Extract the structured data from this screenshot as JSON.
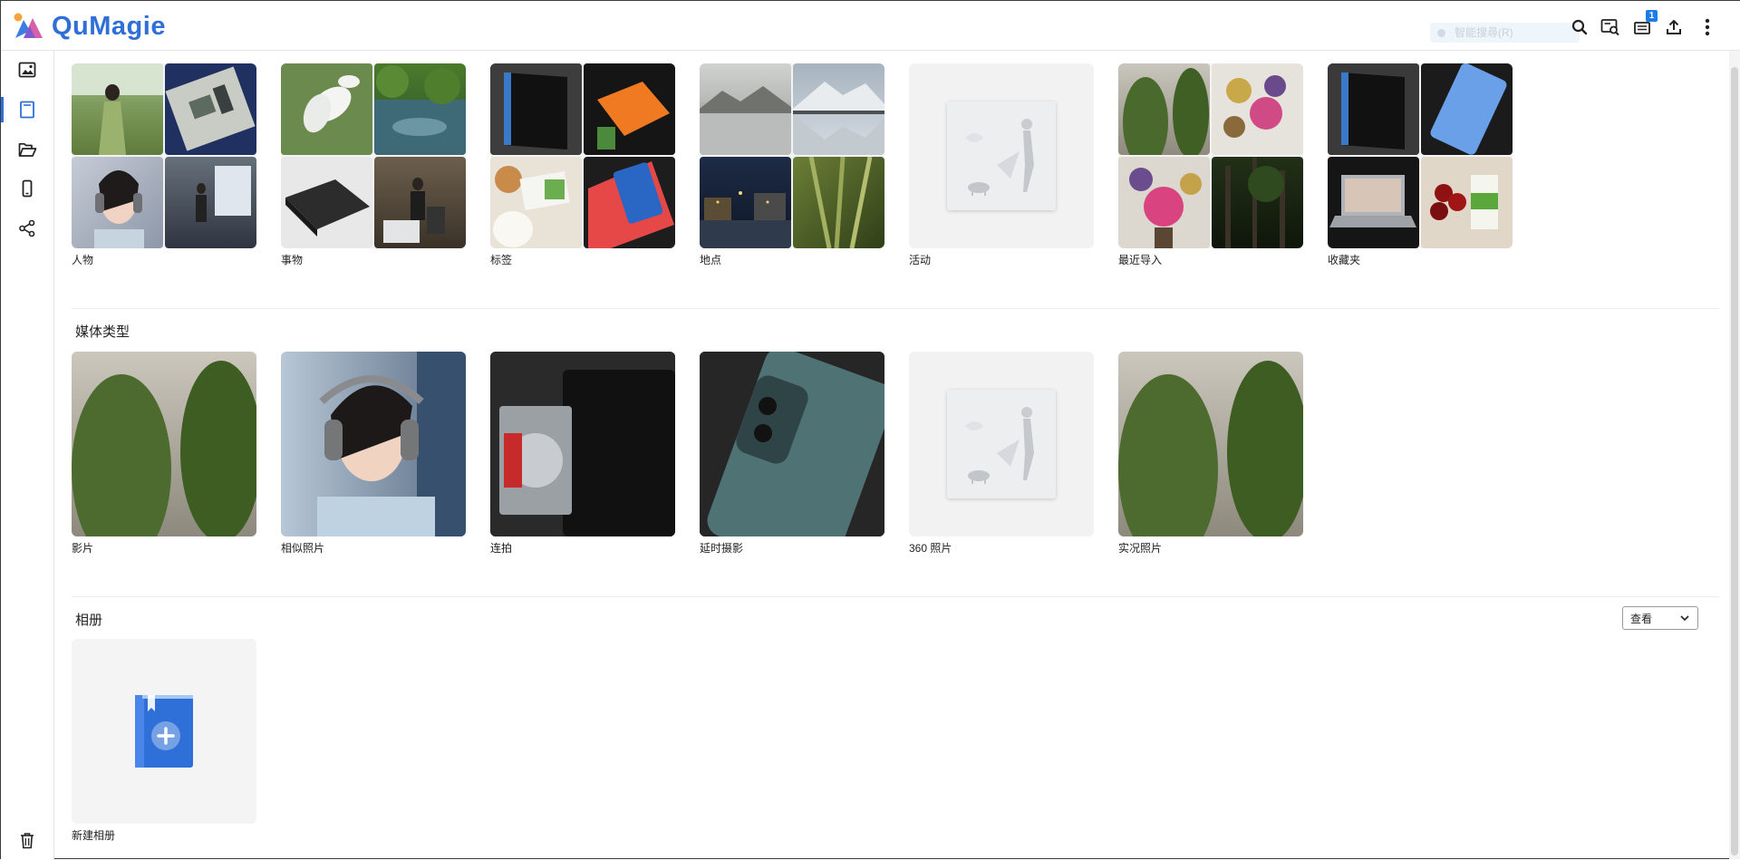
{
  "app": {
    "name": "QuMagie"
  },
  "header": {
    "search_placeholder": "智能搜尋(R)",
    "icons": [
      "search-icon",
      "image-search-icon",
      "background-tasks-icon",
      "upload-icon",
      "more-vertical-icon"
    ],
    "task_badge": "1"
  },
  "sidebar": {
    "items": [
      {
        "name": "photos",
        "icon": "image-icon"
      },
      {
        "name": "albums",
        "icon": "album-book-icon",
        "active": true
      },
      {
        "name": "folders",
        "icon": "folder-open-icon"
      },
      {
        "name": "devices",
        "icon": "mobile-device-icon"
      },
      {
        "name": "sharing",
        "icon": "share-icon"
      }
    ],
    "bottom_icon": "trash-icon"
  },
  "smart_albums": [
    {
      "label": "人物",
      "thumbs": [
        "woman-green-dress",
        "circuit-board",
        "woman-headphones",
        "presenter-stage"
      ]
    },
    {
      "label": "事物",
      "thumbs": [
        "white-cyclamen",
        "forest-pond",
        "network-switch",
        "speaker-event"
      ]
    },
    {
      "label": "标签",
      "thumbs": [
        "nas-device",
        "orange-box",
        "milk-cookies",
        "red-phone-box"
      ]
    },
    {
      "label": "地点",
      "thumbs": [
        "mountain-lake-grey",
        "mountain-lake-reflection",
        "night-town",
        "wheat-field"
      ]
    },
    {
      "label": "活动",
      "thumbs": []
    },
    {
      "label": "最近导入",
      "thumbs": [
        "cactus",
        "dried-flowers",
        "dried-rose",
        "dark-forest"
      ]
    },
    {
      "label": "收藏夹",
      "thumbs": [
        "nas-device",
        "phone-on-mat",
        "laptop",
        "cherries-milk"
      ]
    }
  ],
  "media_types": {
    "title": "媒体类型",
    "items": [
      {
        "label": "影片",
        "thumb": "cactus"
      },
      {
        "label": "相似照片",
        "thumb": "woman-headphones"
      },
      {
        "label": "连拍",
        "thumb": "hdd-enclosure"
      },
      {
        "label": "延时摄影",
        "thumb": "oneplus-phone"
      },
      {
        "label": "360 照片",
        "thumb": ""
      },
      {
        "label": "实况照片",
        "thumb": "cactus"
      }
    ]
  },
  "albums": {
    "title": "相册",
    "view_label": "查看",
    "items": [
      {
        "label": "新建相册",
        "icon": "new-album-icon"
      }
    ]
  },
  "colors": {
    "accent": "#2f6fd8",
    "badge": "#1e7ce6",
    "tile_placeholder": "#f3f3f3"
  }
}
